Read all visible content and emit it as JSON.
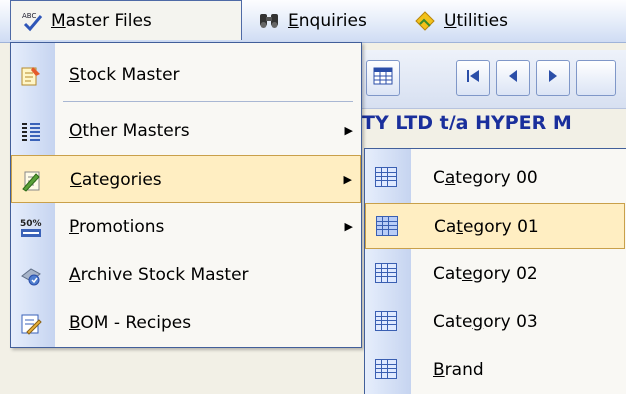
{
  "menubar": {
    "items": [
      {
        "label": "Master Files",
        "accel": "M",
        "rest": "aster Files",
        "icon": "spell-check-icon"
      },
      {
        "label": "Enquiries",
        "accel": "E",
        "rest": "nquiries",
        "icon": "binoculars-icon"
      },
      {
        "label": "Utilities",
        "accel": "U",
        "rest": "tilities",
        "icon": "utilities-diamond-icon"
      }
    ]
  },
  "background": {
    "title_fragment": "TY LTD t/a HYPER M"
  },
  "master_menu": {
    "items": [
      {
        "label": "Stock Master",
        "accel": "S",
        "rest": "tock Master",
        "icon": "stock-master-icon",
        "submenu": false
      },
      {
        "label": "Other Masters",
        "accel": "O",
        "rest": "ther Masters",
        "icon": "other-masters-icon",
        "submenu": true
      },
      {
        "label": "Categories",
        "accel": "C",
        "rest": "ategories",
        "icon": "categories-icon",
        "submenu": true
      },
      {
        "label": "Promotions",
        "accel": "P",
        "rest": "romotions",
        "icon": "promotions-icon",
        "submenu": true
      },
      {
        "label": "Archive Stock Master",
        "accel": "A",
        "rest": "rchive Stock Master",
        "icon": "archive-icon",
        "submenu": false
      },
      {
        "label": "BOM - Recipes",
        "accel": "B",
        "rest": "OM - Recipes",
        "icon": "recipes-icon",
        "submenu": false
      }
    ],
    "highlighted": "Categories",
    "promo_icon_text": "50%"
  },
  "categories_submenu": {
    "items": [
      {
        "pre": "C",
        "accel": "a",
        "post": "tegory 00"
      },
      {
        "pre": "Ca",
        "accel": "t",
        "post": "egory 01"
      },
      {
        "pre": "Cat",
        "accel": "e",
        "post": "gory 02"
      },
      {
        "pre": "Cate",
        "accel": "g",
        "post": "ory 03"
      },
      {
        "pre": "",
        "accel": "B",
        "post": "rand"
      }
    ],
    "highlighted": "Category 01"
  },
  "colors": {
    "highlight_bg": "#ffeec2",
    "highlight_border": "#c9a04a",
    "menu_border": "#425f9a"
  }
}
